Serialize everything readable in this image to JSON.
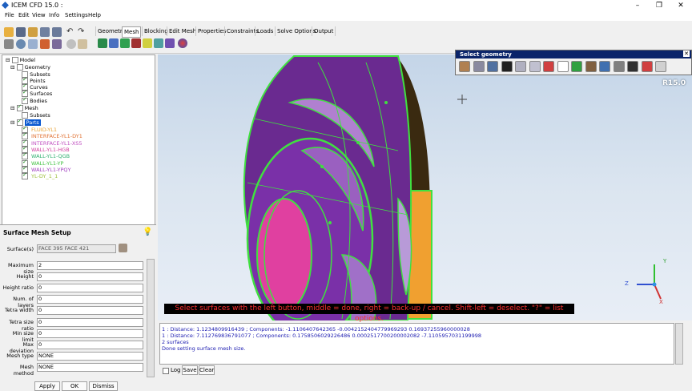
{
  "window": {
    "title": "ICEM CFD 15.0 :"
  },
  "menu": [
    "File",
    "Edit",
    "View",
    "Info",
    "Settings",
    "Help"
  ],
  "tabs": [
    "Geometry",
    "Mesh",
    "Blocking",
    "Edit Mesh",
    "Properties",
    "Constraints",
    "Loads",
    "Solve Options",
    "Output"
  ],
  "active_tab": "Mesh",
  "tree": {
    "model": "Model",
    "geometry": "Geometry",
    "geometry_children": [
      "Subsets",
      "Points",
      "Curves",
      "Surfaces",
      "Bodies"
    ],
    "mesh": "Mesh",
    "mesh_children": [
      "Subsets"
    ],
    "parts": "Parts",
    "part_items": [
      {
        "label": "FLUID-YL1",
        "color": "#e8a030"
      },
      {
        "label": "INTERFACE-YL1-DY1",
        "color": "#e07030"
      },
      {
        "label": "INTERFACE-YL1-XS5",
        "color": "#c050c0"
      },
      {
        "label": "WALL-YL1-HGB",
        "color": "#d040a0"
      },
      {
        "label": "WALL-YL1-QGB",
        "color": "#30b070"
      },
      {
        "label": "WALL-YL1-YP",
        "color": "#40c040"
      },
      {
        "label": "WALL-YL1-YPQY",
        "color": "#a040c0"
      },
      {
        "label": "YL-DY_1_1",
        "color": "#a0c040"
      }
    ]
  },
  "setup": {
    "title": "Surface Mesh Setup",
    "surfaces_label": "Surface(s)",
    "surfaces_value": "FACE 395 FACE 421",
    "fields": [
      {
        "label": "Maximum size",
        "value": "2"
      },
      {
        "label": "Height",
        "value": "0"
      },
      {
        "label": "Height ratio",
        "value": "0"
      },
      {
        "label": "Num. of layers",
        "value": "0"
      },
      {
        "label": "Tetra width",
        "value": "0"
      },
      {
        "label": "Tetra size ratio",
        "value": "0"
      },
      {
        "label": "Min size limit",
        "value": "0"
      },
      {
        "label": "Max deviation",
        "value": "0"
      },
      {
        "label": "Mesh type",
        "value": "NONE"
      },
      {
        "label": "Mesh method",
        "value": "NONE"
      }
    ],
    "apply": "Apply",
    "ok": "OK",
    "dismiss": "Dismiss"
  },
  "select_geometry": {
    "title": "Select geometry"
  },
  "viewport": {
    "version": "R15.0",
    "axes": [
      "Y",
      "Z",
      "X"
    ]
  },
  "status_message": "Select surfaces with the left button, middle = done, right = back-up / cancel. Shift-left = deselect. \"?\" = list options.",
  "console": [
    "1 : Distance: 1.1234809916439 ; Components:   -1.1106407642365 -0.0042152404779969293 0.16937255960000028",
    "1 : Distance: 7.112769836791077 ; Components:   0.1758506029226486 0.0002517700200002082 -7.1105957031199998",
    "2 surfaces",
    "Done setting surface mesh size."
  ],
  "console_controls": {
    "log": "Log",
    "save": "Save",
    "clear": "Clear"
  },
  "colors": {
    "accent": "#0a246a",
    "mesh_green": "#40e040",
    "impeller_purple": "#7a2aa0",
    "hub_pink": "#e040a0",
    "outlet_orange": "#f0a030"
  }
}
